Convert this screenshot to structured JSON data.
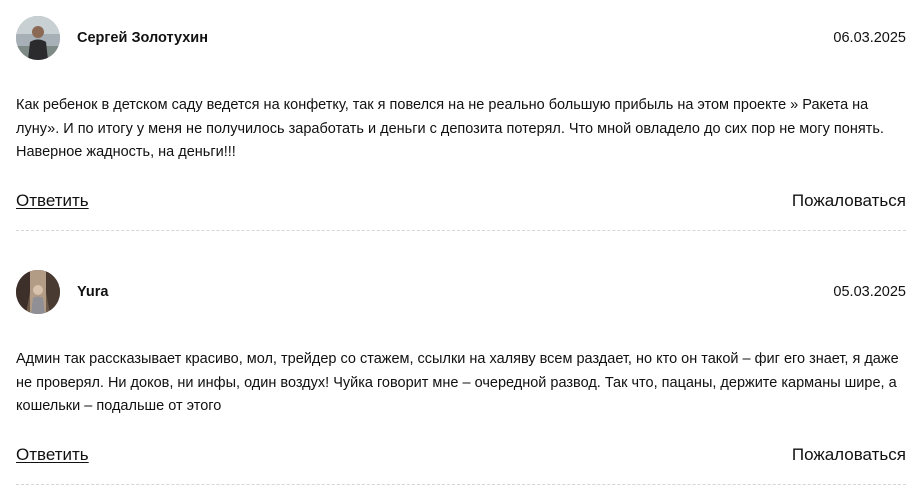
{
  "comments": [
    {
      "author": "Сергей Золотухин",
      "date": "06.03.2025",
      "text": "Как ребенок в детском саду ведется на конфетку, так я повелся на не реально большую прибыль на этом проекте » Ракета на луну». И по итогу у меня не получилось заработать и деньги с депозита потерял. Что мной овладело до сих пор не могу понять. Наверное жадность, на деньги!!!",
      "reply_label": "Ответить",
      "report_label": "Пожаловаться"
    },
    {
      "author": "Yura",
      "date": "05.03.2025",
      "text": "Админ так рассказывает красиво, мол, трейдер со стажем, ссылки на халяву всем раздает, но кто он такой – фиг его знает, я даже не проверял. Ни доков, ни инфы, один воздух! Чуйка говорит мне – очередной развод. Так что, пацаны, держите карманы шире, а кошельки – подальше от этого",
      "reply_label": "Ответить",
      "report_label": "Пожаловаться"
    }
  ]
}
